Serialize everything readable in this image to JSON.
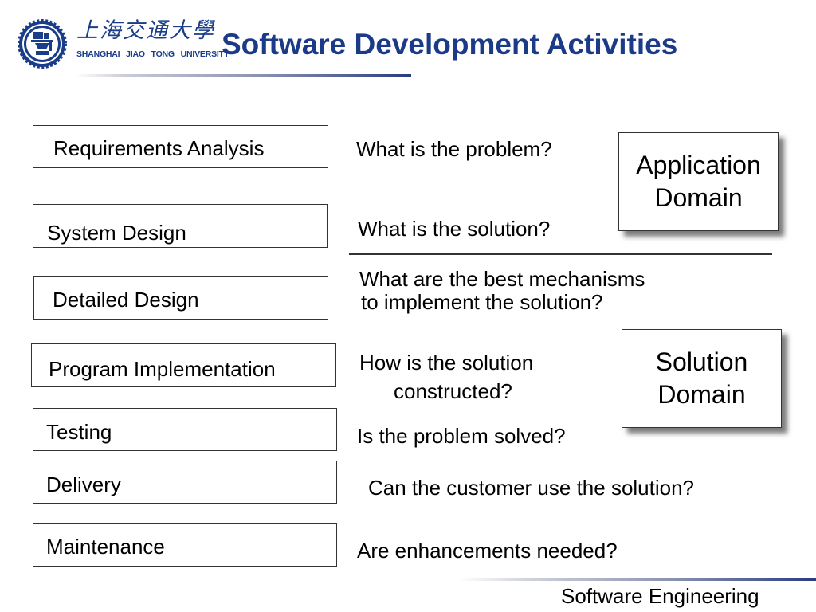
{
  "header": {
    "logo": {
      "chinese_name": "上海交通大學",
      "english_name": "SHANGHAI JIAO TONG UNIVERSITY",
      "icon": "university-emblem-icon"
    },
    "title": "Software Development Activities"
  },
  "activities": [
    {
      "label": "Requirements Analysis"
    },
    {
      "label": "System Design"
    },
    {
      "label": "Detailed Design"
    },
    {
      "label": "Program Implementation"
    },
    {
      "label": "Testing"
    },
    {
      "label": "Delivery"
    },
    {
      "label": "Maintenance"
    }
  ],
  "questions": [
    {
      "text": "What is the problem?"
    },
    {
      "text": "What is the solution?"
    },
    {
      "text": "What are the best mechanisms",
      "text2": "to implement the solution?"
    },
    {
      "text": "How is the solution",
      "text2": "constructed?"
    },
    {
      "text": "Is the problem solved?"
    },
    {
      "text": "Can the customer use the solution?"
    },
    {
      "text": "Are enhancements needed?"
    }
  ],
  "domains": [
    {
      "line1": "Application",
      "line2": "Domain"
    },
    {
      "line1": "Solution",
      "line2": "Domain"
    }
  ],
  "footer": {
    "text": "Software Engineering"
  },
  "colors": {
    "title": "#1b3a87",
    "logo": "#1a3d8a",
    "box_border": "#333333"
  }
}
